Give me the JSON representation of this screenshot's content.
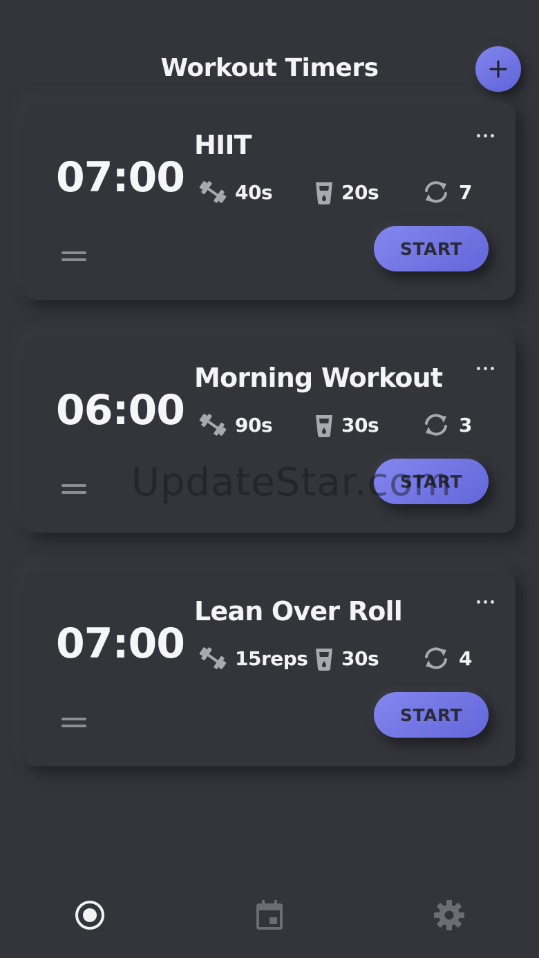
{
  "header": {
    "title": "Workout Timers",
    "add_icon": "plus-icon"
  },
  "timers": [
    {
      "name": "HIIT",
      "total": "07:00",
      "work": "40s",
      "rest": "20s",
      "rounds": "7",
      "start_label": "START"
    },
    {
      "name": "Morning Workout",
      "total": "06:00",
      "work": "90s",
      "rest": "30s",
      "rounds": "3",
      "start_label": "START"
    },
    {
      "name": "Lean Over Roll",
      "total": "07:00",
      "work": "15reps",
      "rest": "30s",
      "rounds": "4",
      "start_label": "START"
    }
  ],
  "watermark": "UpdateStar.com",
  "bottom_nav": {
    "items": [
      "timer-radio-icon",
      "calendar-icon",
      "gear-icon"
    ],
    "active_index": 0
  },
  "colors": {
    "background": "#33353b",
    "accent": "#7376e6",
    "button_text": "#2a2b36",
    "icon_muted": "#8c8d93"
  }
}
